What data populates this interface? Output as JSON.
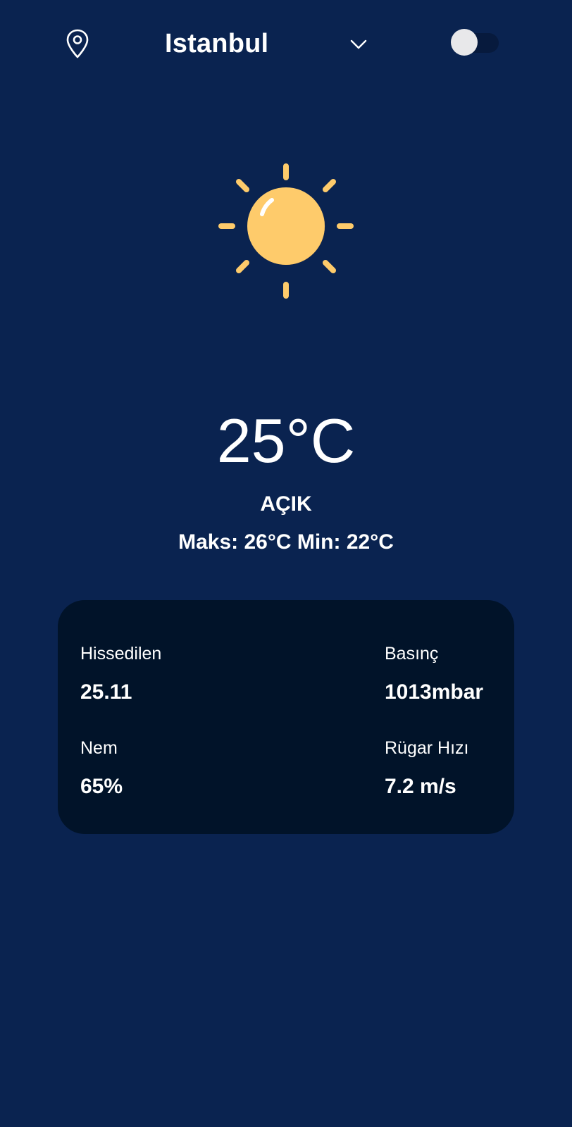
{
  "header": {
    "city": "Istanbul",
    "location_icon": "location-pin-icon",
    "dropdown_icon": "chevron-down-icon",
    "theme_toggle_on": false
  },
  "weather": {
    "icon": "sun-icon",
    "temperature": "25°C",
    "condition": "AÇIK",
    "min_max": "Maks: 26°C Min: 22°C"
  },
  "details": {
    "feels_like": {
      "label": "Hissedilen",
      "value": "25.11"
    },
    "pressure": {
      "label": "Basınç",
      "value": "1013mbar"
    },
    "humidity": {
      "label": "Nem",
      "value": "65%"
    },
    "wind_speed": {
      "label": "Rügar Hızı",
      "value": "7.2 m/s"
    }
  },
  "colors": {
    "background": "#0a2350",
    "card": "#011329",
    "sun": "#fecb6b",
    "sun_rays": "#fecb6b",
    "text": "#ffffff"
  }
}
